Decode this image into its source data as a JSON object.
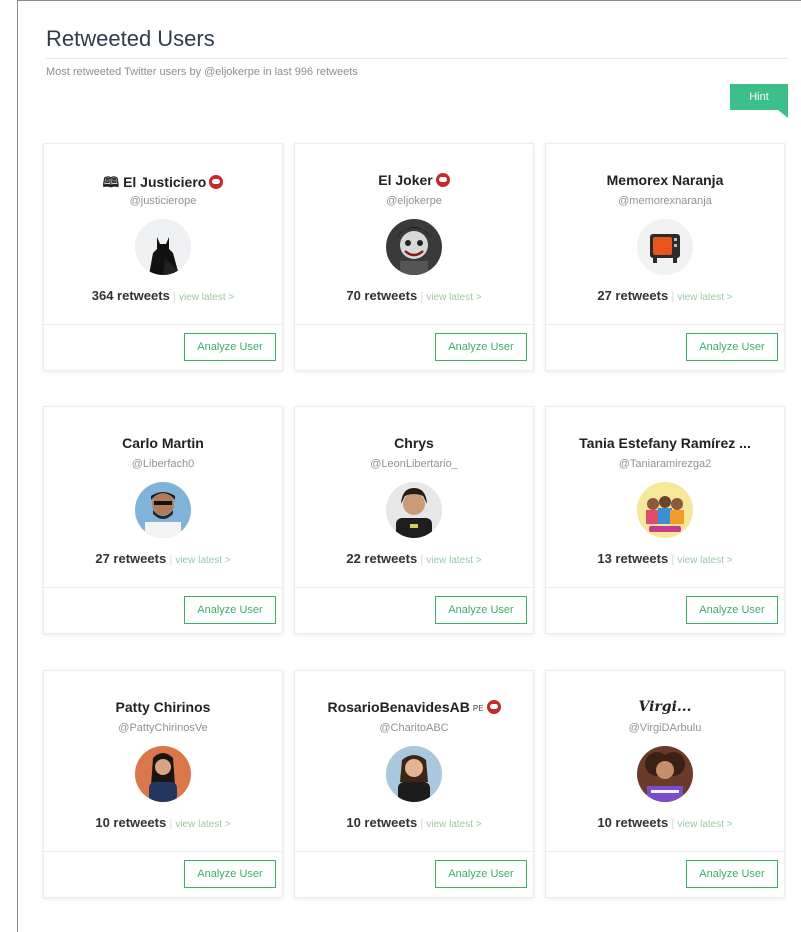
{
  "header": {
    "title": "Retweeted Users",
    "subtitle": "Most retweeted Twitter users by @eljokerpe in last 996 retweets",
    "hint_label": "Hint"
  },
  "users": [
    {
      "name": "🕮 El Justiciero",
      "handle": "@justicierope",
      "retweets": "364 retweets",
      "view_latest": "view latest >",
      "analyze": "Analyze User",
      "avatar": "batman-silhouette"
    },
    {
      "name": "El Joker",
      "handle": "@eljokerpe",
      "retweets": "70 retweets",
      "view_latest": "view latest >",
      "analyze": "Analyze User",
      "avatar": "joker-portrait"
    },
    {
      "name": "Memorex Naranja",
      "handle": "@memorexnaranja",
      "retweets": "27 retweets",
      "view_latest": "view latest >",
      "analyze": "Analyze User",
      "avatar": "retro-tv"
    },
    {
      "name": "Carlo Martin",
      "handle": "@Liberfach0",
      "retweets": "27 retweets",
      "view_latest": "view latest >",
      "analyze": "Analyze User",
      "avatar": "man-sunglasses"
    },
    {
      "name": "Chrys",
      "handle": "@LeonLibertario_",
      "retweets": "22 retweets",
      "view_latest": "view latest >",
      "analyze": "Analyze User",
      "avatar": "person-dark-shirt"
    },
    {
      "name": "Tania Estefany Ramírez ...",
      "handle": "@Taniaramirezga2",
      "retweets": "13 retweets",
      "view_latest": "view latest >",
      "analyze": "Analyze User",
      "avatar": "group-photo"
    },
    {
      "name": "Patty Chirinos",
      "handle": "@PattyChirinosVe",
      "retweets": "10 retweets",
      "view_latest": "view latest >",
      "analyze": "Analyze User",
      "avatar": "woman-portrait"
    },
    {
      "name": "RosarioBenavidesAB",
      "name_suffix": "PE",
      "handle": "@CharitoABC",
      "retweets": "10 retweets",
      "view_latest": "view latest >",
      "analyze": "Analyze User",
      "avatar": "woman-portrait-blue"
    },
    {
      "name": "Virgi...",
      "handle": "@VirgiDArbulu",
      "retweets": "10 retweets",
      "view_latest": "view latest >",
      "analyze": "Analyze User",
      "avatar": "woman-curly-hair"
    }
  ]
}
